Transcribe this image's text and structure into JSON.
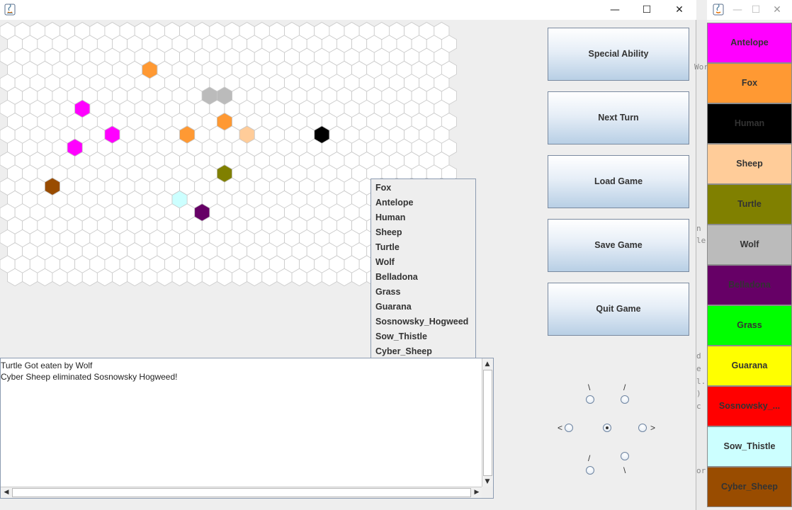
{
  "main_window": {
    "controls": {
      "minimize": "—",
      "maximize": "☐",
      "close": "✕"
    }
  },
  "board": {
    "grid_color": "#c8c8c8",
    "organisms": [
      {
        "species": "Fox",
        "color": "#ff9933"
      },
      {
        "species": "Wolf",
        "color": "#bbbbbb"
      },
      {
        "species": "Wolf",
        "color": "#bbbbbb"
      },
      {
        "species": "Antelope",
        "color": "#ff00ff"
      },
      {
        "species": "Fox",
        "color": "#ff9933"
      },
      {
        "species": "Antelope",
        "color": "#ff00ff"
      },
      {
        "species": "Fox",
        "color": "#ff9933"
      },
      {
        "species": "Sheep",
        "color": "#ffcc99"
      },
      {
        "species": "Human",
        "color": "#000000"
      },
      {
        "species": "Antelope",
        "color": "#ff00ff"
      },
      {
        "species": "Turtle",
        "color": "#808000"
      },
      {
        "species": "Cyber_Sheep",
        "color": "#994c00"
      },
      {
        "species": "Sow_Thistle",
        "color": "#ccffff"
      },
      {
        "species": "Belladona",
        "color": "#660066"
      }
    ]
  },
  "popup": {
    "items": [
      "Fox",
      "Antelope",
      "Human",
      "Sheep",
      "Turtle",
      "Wolf",
      "Belladona",
      "Grass",
      "Guarana",
      "Sosnowsky_Hogweed",
      "Sow_Thistle",
      "Cyber_Sheep"
    ]
  },
  "log": {
    "lines": [
      "Turtle Got eaten by Wolf",
      "Cyber Sheep eliminated Sosnowsky Hogweed!"
    ]
  },
  "buttons": {
    "special": "Special Ability",
    "next": "Next Turn",
    "load": "Load Game",
    "save": "Save Game",
    "quit": "Quit Game"
  },
  "direction": {
    "labels": {
      "up_left": "\\",
      "up_right": "/",
      "left": "<",
      "right": ">",
      "down_left": "/",
      "down_right": "\\"
    },
    "selected": "center"
  },
  "legend_window": {
    "controls": {
      "minimize": "—",
      "maximize": "☐",
      "close": "✕"
    },
    "items": [
      {
        "label": "Antelope",
        "bg": "#ff00ff",
        "fg": "#333333"
      },
      {
        "label": "Fox",
        "bg": "#ff9933",
        "fg": "#333333"
      },
      {
        "label": "Human",
        "bg": "#000000",
        "fg": "#333333"
      },
      {
        "label": "Sheep",
        "bg": "#ffcc99",
        "fg": "#333333"
      },
      {
        "label": "Turtle",
        "bg": "#808000",
        "fg": "#333333"
      },
      {
        "label": "Wolf",
        "bg": "#bbbbbb",
        "fg": "#333333"
      },
      {
        "label": "Belladona",
        "bg": "#660066",
        "fg": "#333333"
      },
      {
        "label": "Grass",
        "bg": "#00ff00",
        "fg": "#333333"
      },
      {
        "label": "Guarana",
        "bg": "#ffff00",
        "fg": "#333333"
      },
      {
        "label": "Sosnowsky_...",
        "bg": "#ff0000",
        "fg": "#333333"
      },
      {
        "label": "Sow_Thistle",
        "bg": "#ccffff",
        "fg": "#333333"
      },
      {
        "label": "Cyber_Sheep",
        "bg": "#994c00",
        "fg": "#333333"
      }
    ]
  },
  "background_window": {
    "fragments": [
      "Wor",
      "n",
      "le",
      "d",
      "e",
      "l.",
      ")",
      "c",
      "or"
    ]
  }
}
